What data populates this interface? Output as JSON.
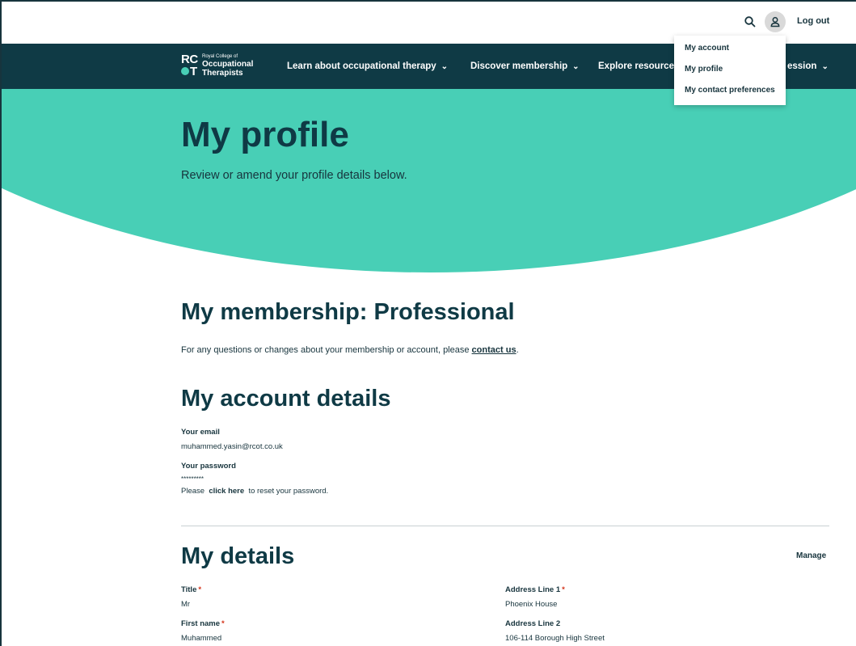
{
  "header": {
    "logout_label": "Log out",
    "search_icon": "search-icon",
    "avatar_icon": "user-icon"
  },
  "logo": {
    "mark_top": "RC",
    "mark_bottom": "T",
    "small_text": "Royal College of",
    "line1": "Occupational",
    "line2": "Therapists"
  },
  "nav": {
    "items": [
      {
        "label": "Learn about occupational therapy"
      },
      {
        "label": "Discover membership"
      },
      {
        "label": "Explore resource"
      },
      {
        "label": "ession"
      }
    ],
    "chevron": "⌄"
  },
  "dropdown": {
    "items": [
      {
        "label": "My account"
      },
      {
        "label": "My profile"
      },
      {
        "label": "My contact preferences"
      }
    ]
  },
  "hero": {
    "title": "My profile",
    "subtitle": "Review or amend your profile details below."
  },
  "membership": {
    "heading": "My membership: Professional",
    "text_before": "For any questions or changes about your membership or account, please ",
    "link": "contact us",
    "text_after": "."
  },
  "account": {
    "heading": "My account details",
    "email_label": "Your email",
    "email_value": "muhammed.yasin@rcot.co.uk",
    "password_label": "Your password",
    "password_value": "*********",
    "reset_before": "Please ",
    "reset_link": "click here",
    "reset_after": " to reset your password."
  },
  "details": {
    "heading": "My details",
    "manage_label": "Manage",
    "required_mark": "*",
    "fields": [
      {
        "label": "Title",
        "value": "Mr"
      },
      {
        "label": "First name",
        "value": "Muhammed"
      },
      {
        "label": "Address Line 1",
        "value": "Phoenix House"
      },
      {
        "label": "Address Line 2",
        "value": "106-114 Borough High Street"
      }
    ]
  },
  "colors": {
    "navy": "#0f3a45",
    "teal": "#48cfb6",
    "required": "#d4351c"
  }
}
